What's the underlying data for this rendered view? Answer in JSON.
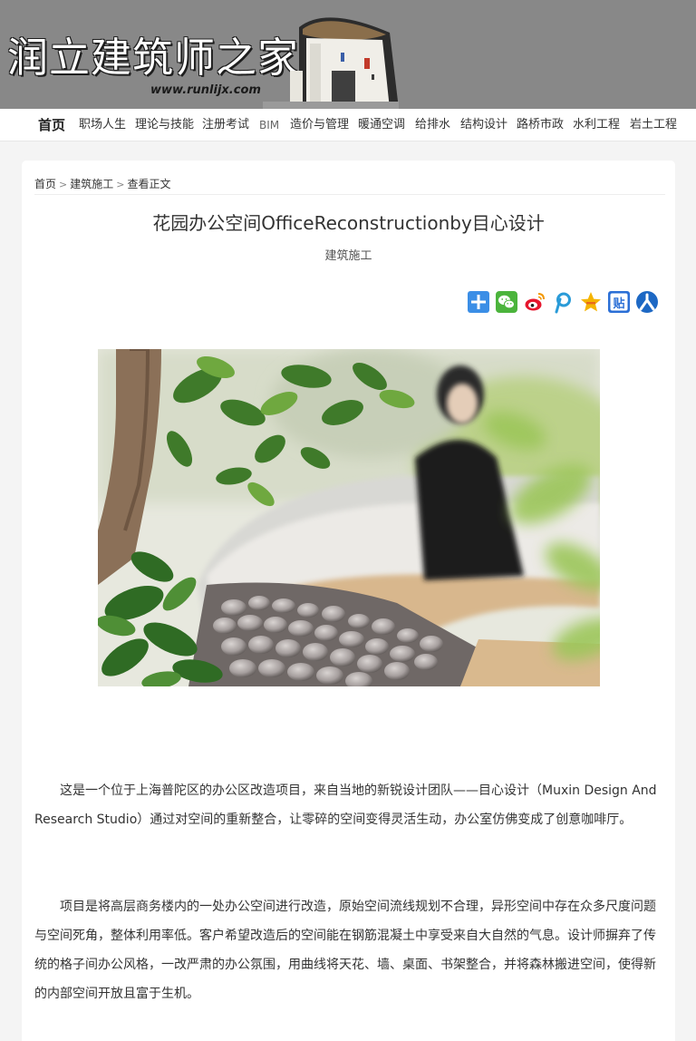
{
  "site": {
    "title": "润立建筑师之家",
    "url": "www.runlijx.com"
  },
  "nav": {
    "items": [
      {
        "label": "首页",
        "name": "nav-item-home"
      },
      {
        "label": "职场人生",
        "name": "nav-item-career"
      },
      {
        "label": "理论与技能",
        "name": "nav-item-theory"
      },
      {
        "label": "注册考试",
        "name": "nav-item-exam"
      },
      {
        "label": "BIM",
        "name": "nav-item-bim"
      },
      {
        "label": "造价与管理",
        "name": "nav-item-cost"
      },
      {
        "label": "暖通空调",
        "name": "nav-item-hvac"
      },
      {
        "label": "给排水",
        "name": "nav-item-plumbing"
      },
      {
        "label": "结构设计",
        "name": "nav-item-structure"
      },
      {
        "label": "路桥市政",
        "name": "nav-item-roads"
      },
      {
        "label": "水利工程",
        "name": "nav-item-hydraulic"
      },
      {
        "label": "岩土工程",
        "name": "nav-item-geotech"
      }
    ]
  },
  "breadcrumb": {
    "home": "首页",
    "section": "建筑施工",
    "current": "查看正文",
    "separator": ">"
  },
  "article": {
    "title": "花园办公空间OfficeReconstructionby目心设计",
    "category": "建筑施工",
    "paragraphs": [
      "这是一个位于上海普陀区的办公区改造项目，来自当地的新锐设计团队——目心设计（Muxin Design And Research Studio）通过对空间的重新整合，让零碎的空间变得灵活生动，办公室仿佛变成了创意咖啡厅。",
      "项目是将高层商务楼内的一处办公空间进行改造，原始空间流线规划不合理，异形空间中存在众多尺度问题与空间死角，整体利用率低。客户希望改造后的空间能在钢筋混凝土中享受来自大自然的气息。设计师摒弃了传统的格子间办公风格，一改严肃的办公氛围，用曲线将天花、墙、桌面、书架整合，并将森林搬进空间，使得新的内部空间开放且富于生机。"
    ]
  },
  "share": {
    "buttons": [
      {
        "name": "share-more-icon",
        "color": "#3b8ee6"
      },
      {
        "name": "wechat-icon",
        "color": "#4bb43c"
      },
      {
        "name": "weibo-icon",
        "color": "#e6162d"
      },
      {
        "name": "pinterest-icon",
        "color": "#2a9bd8"
      },
      {
        "name": "qzone-icon",
        "color": "#f5b400"
      },
      {
        "name": "tieba-icon",
        "color": "#2b6fd6"
      },
      {
        "name": "renren-icon",
        "color": "#1d68c4"
      }
    ]
  },
  "colors": {
    "banner": "#888888",
    "page_bg": "#f4f4f4"
  }
}
